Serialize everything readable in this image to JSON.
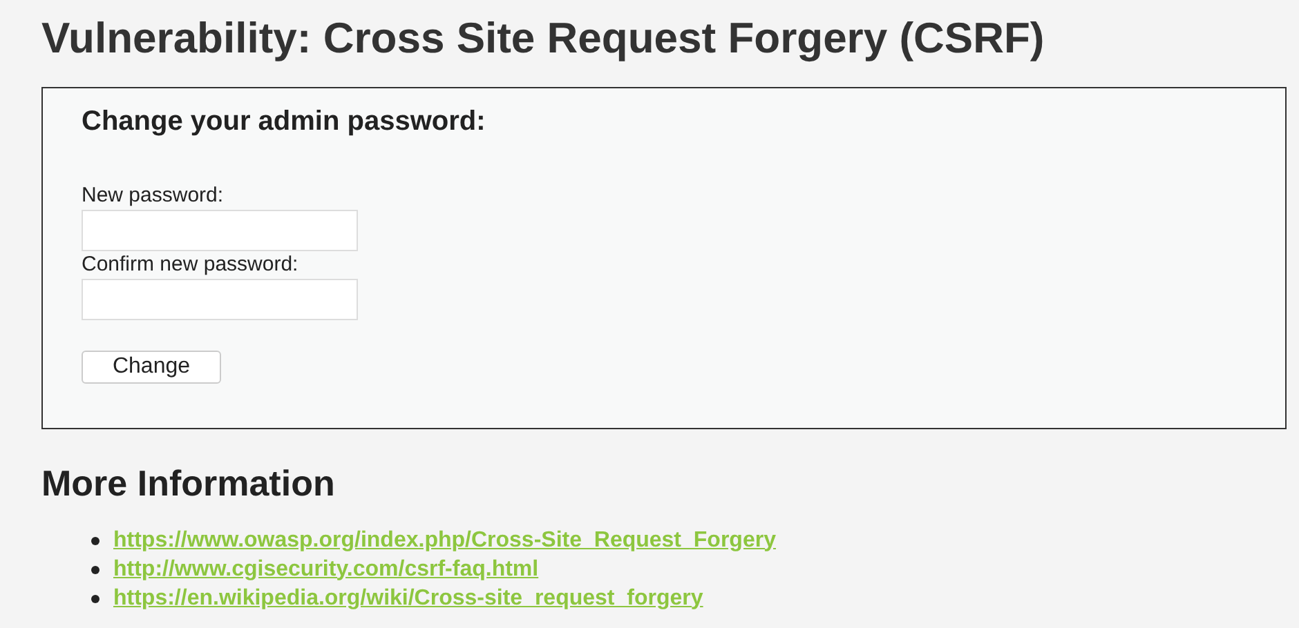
{
  "page_title": "Vulnerability: Cross Site Request Forgery (CSRF)",
  "form": {
    "heading": "Change your admin password:",
    "fields": [
      {
        "label": "New password:"
      },
      {
        "label": "Confirm new password:"
      }
    ],
    "button": "Change"
  },
  "more_info": {
    "heading": "More Information",
    "links": [
      "https://www.owasp.org/index.php/Cross-Site_Request_Forgery",
      "http://www.cgisecurity.com/csrf-faq.html",
      "https://en.wikipedia.org/wiki/Cross-site_request_forgery"
    ]
  }
}
